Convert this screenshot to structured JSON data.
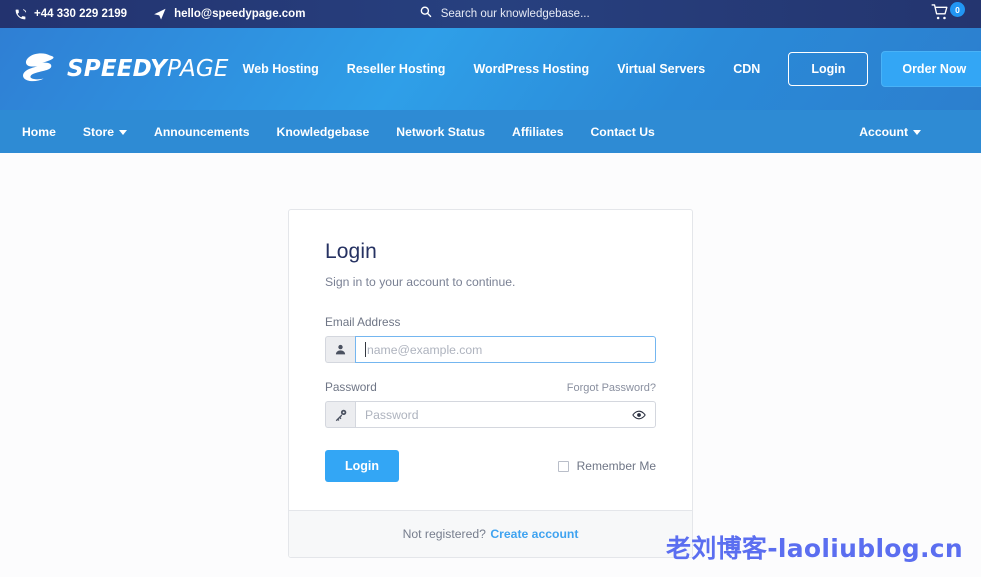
{
  "topbar": {
    "phone": "+44 330 229 2199",
    "phone_icon": "phone-icon",
    "email": "hello@speedypage.com",
    "email_icon": "paper-plane-icon",
    "search_placeholder": "Search our knowledgebase...",
    "search_icon": "search-icon",
    "cart_icon": "shopping-cart-icon",
    "cart_count": "0",
    "bg_color": "#25386f"
  },
  "header": {
    "logo_bold": "SPEEDY",
    "logo_light": "PAGE",
    "logo_icon": "speedypage-s-mark",
    "nav": [
      {
        "label": "Web Hosting"
      },
      {
        "label": "Reseller Hosting"
      },
      {
        "label": "WordPress Hosting"
      },
      {
        "label": "Virtual Servers"
      },
      {
        "label": "CDN"
      }
    ],
    "login_label": "Login",
    "order_label": "Order Now",
    "accent_color": "#33a6f5"
  },
  "subnav": {
    "items": [
      {
        "label": "Home",
        "caret": false
      },
      {
        "label": "Store",
        "caret": true
      },
      {
        "label": "Announcements",
        "caret": false
      },
      {
        "label": "Knowledgebase",
        "caret": false
      },
      {
        "label": "Network Status",
        "caret": false
      },
      {
        "label": "Affiliates",
        "caret": false
      },
      {
        "label": "Contact Us",
        "caret": false
      }
    ],
    "account_label": "Account",
    "bg_color": "#2e8bd4"
  },
  "login_card": {
    "title": "Login",
    "subtitle": "Sign in to your account to continue.",
    "email_label": "Email Address",
    "email_placeholder": "name@example.com",
    "email_value": "",
    "email_icon": "user-icon",
    "password_label": "Password",
    "password_placeholder": "Password",
    "password_value": "",
    "password_icon": "key-icon",
    "toggle_password_icon": "eye-icon",
    "forgot_label": "Forgot Password?",
    "submit_label": "Login",
    "remember_label": "Remember Me",
    "remember_checked": false,
    "footer_text": "Not registered?",
    "footer_link": "Create account"
  },
  "watermark": {
    "text": "老刘博客-laoliublog.cn",
    "color": "#5b6ef0"
  }
}
